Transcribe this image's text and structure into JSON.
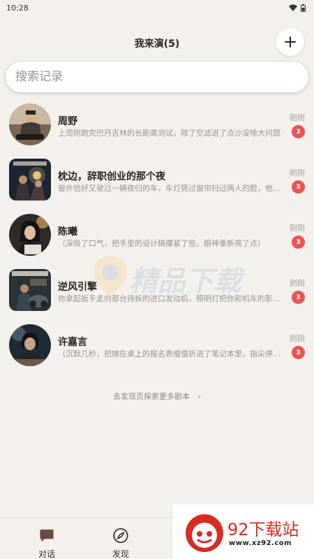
{
  "status_bar": {
    "time": "10:28"
  },
  "header": {
    "title": "我来演(5)"
  },
  "search": {
    "placeholder": "搜索记录"
  },
  "chats": [
    {
      "name": "周野",
      "preview": "上周刚跑完巴丹吉林的长距离测试，除了空滤进了点沙没啥大问题",
      "time": "刚刚",
      "unread": "3"
    },
    {
      "name": "枕边，辞职创业的那个夜",
      "preview": "窗外恰好又驶过一辆夜归的车，车灯晃过窗帘扫过两人的脸，他的眼神",
      "time": "刚刚",
      "unread": "3"
    },
    {
      "name": "陈曦",
      "preview": "（深吸了口气，把手里的设计稿攥紧了些，眼神重新亮了点）",
      "time": "刚刚",
      "unread": "3"
    },
    {
      "name": "逆风引擎",
      "preview": "你拿起扳手走向那台待拆的进口发动机，照明灯把你和机车的影子拉长",
      "time": "刚刚",
      "unread": "3"
    },
    {
      "name": "许嘉言",
      "preview": "（沉默几秒，把摊在桌上的报名表慢慢折进了笔记本里，指尖停了停）",
      "time": "刚刚",
      "unread": "3"
    }
  ],
  "discover_link": "去发现页探索更多剧本",
  "watermark": "精品下载",
  "bottom_nav": {
    "tab_chat": "对话",
    "tab_discover": "发现"
  },
  "brand_badge": {
    "name": "92下载站",
    "url": "www.xz92.com"
  },
  "colors": {
    "background": "#f4f1ec",
    "badge_red": "#ea5455",
    "brand_red": "#d62c24"
  }
}
